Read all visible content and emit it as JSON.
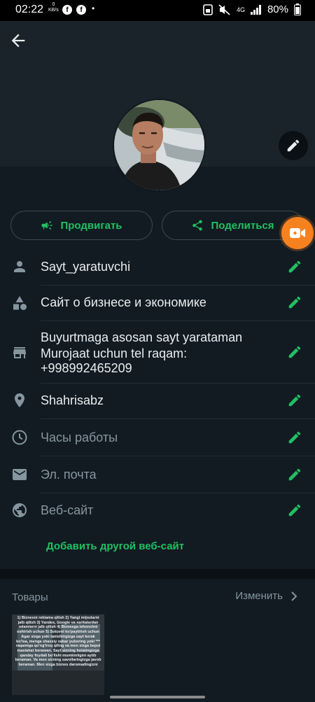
{
  "status_bar": {
    "time": "02:22",
    "kbs_value": "0",
    "kbs_unit": "KB/s",
    "network": "4G",
    "battery": "80%"
  },
  "promote": {
    "label": "Продвигать"
  },
  "share": {
    "label": "Поделиться"
  },
  "fields": {
    "name": "Sayt_yaratuvchi",
    "category": "Сайт о бизнесе и экономике",
    "description_line1": "Buyurtmaga asosan sayt yarataman",
    "description_line2": "Murojaat uchun tel raqam:",
    "description_line3": "+998992465209",
    "location": "Shahrisabz",
    "hours_placeholder": "Часы работы",
    "email_placeholder": "Эл. почта",
    "website_placeholder": "Веб-сайт"
  },
  "add_website": "Добавить другой веб-сайт",
  "products": {
    "title": "Товары",
    "change": "Изменить",
    "thumb_text": "1) Biznesni reklama qilish 2) Yangi mijozlarni jalb qilish 3) Yandex, Google va xaritalardan odamlarni jalb qilish 4) Biznesga ishonchni oshirish uchun 5) Sotuvni ko'paytirish uchun Agar sizga yoki tanishingizga sayt kerak bo'lsa, menga shaxsiy xabar yuboring yoki *** raqamiga qo'ng'iroq qiling va men sizga bepul maslahat beraman. Sayt sizning holatingizga qanday foydali bo'lishi mumkinligini aytib beraman. Va men sizning savollaringizga javob beraman. Men sizga biznes daromadingizni"
  },
  "colors": {
    "accent": "#21c063",
    "background": "#121b22",
    "video_fab": "#f6821f"
  }
}
